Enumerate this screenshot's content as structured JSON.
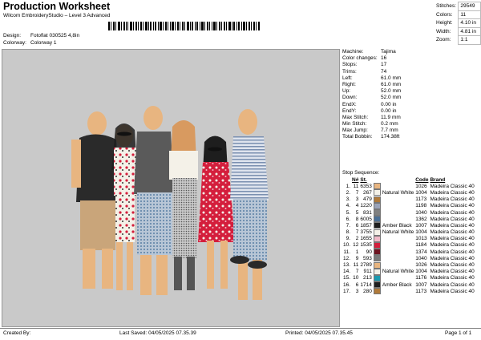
{
  "header": {
    "title": "Production Worksheet",
    "subtitle": "Wilcom EmbroideryStudio – Level 3 Advanced",
    "design_label": "Design:",
    "design_value": "Fotoflat 030525 4,8in",
    "colorway_label": "Colorway:",
    "colorway_value": "Colorway 1"
  },
  "stats": [
    {
      "label": "Stitches:",
      "value": "29549"
    },
    {
      "label": "Colors:",
      "value": "11"
    },
    {
      "label": "Height:",
      "value": "4.10 in"
    },
    {
      "label": "Width:",
      "value": "4.81 in"
    },
    {
      "label": "Zoom:",
      "value": "1:1"
    }
  ],
  "machine_info": [
    {
      "label": "Machine:",
      "value": "Tajima"
    },
    {
      "label": "Color changes:",
      "value": "16"
    },
    {
      "label": "Stops:",
      "value": "17"
    },
    {
      "label": "Trims:",
      "value": "74"
    },
    {
      "label": "Left:",
      "value": "61.0 mm"
    },
    {
      "label": "Right:",
      "value": "61.0 mm"
    },
    {
      "label": "Up:",
      "value": "52.0 mm"
    },
    {
      "label": "Down:",
      "value": "52.0 mm"
    },
    {
      "label": "EndX:",
      "value": "0.00 in"
    },
    {
      "label": "EndY:",
      "value": "0.00 in"
    },
    {
      "label": "Max Stitch:",
      "value": "11.9 mm"
    },
    {
      "label": "Min Stitch:",
      "value": "0.2 mm"
    },
    {
      "label": "Max Jump:",
      "value": "7.7 mm"
    },
    {
      "label": "Total Bobbin:",
      "value": "174.38ft"
    }
  ],
  "stop_sequence": {
    "title": "Stop Sequence:",
    "columns": [
      "N#",
      "St.",
      "Code",
      "Brand"
    ],
    "rows": [
      {
        "stop": "1.",
        "n": "11",
        "st": "6353",
        "color": "#e8b580",
        "name": "",
        "code": "1026",
        "brand": "Madeira Classic 40"
      },
      {
        "stop": "2.",
        "n": "7",
        "st": "267",
        "color": "#f4f1e8",
        "name": "Natural White",
        "code": "1004",
        "brand": "Madeira Classic 40"
      },
      {
        "stop": "3.",
        "n": "3",
        "st": "479",
        "color": "#b07a3a",
        "name": "",
        "code": "1173",
        "brand": "Madeira Classic 40"
      },
      {
        "stop": "4.",
        "n": "4",
        "st": "1220",
        "color": "#9aa3b8",
        "name": "",
        "code": "1198",
        "brand": "Madeira Classic 40"
      },
      {
        "stop": "5.",
        "n": "5",
        "st": "831",
        "color": "#808080",
        "name": "",
        "code": "1040",
        "brand": "Madeira Classic 40"
      },
      {
        "stop": "6.",
        "n": "8",
        "st": "6005",
        "color": "#4a6f95",
        "name": "",
        "code": "1362",
        "brand": "Madeira Classic 40"
      },
      {
        "stop": "7.",
        "n": "6",
        "st": "1857",
        "color": "#1e1e1e",
        "name": "Amber Black",
        "code": "1007",
        "brand": "Madeira Classic 40"
      },
      {
        "stop": "8.",
        "n": "7",
        "st": "3755",
        "color": "#f4f1e8",
        "name": "Natural White",
        "code": "1004",
        "brand": "Madeira Classic 40"
      },
      {
        "stop": "9.",
        "n": "2",
        "st": "1655",
        "color": "#f0b8c6",
        "name": "",
        "code": "1013",
        "brand": "Madeira Classic 40"
      },
      {
        "stop": "10.",
        "n": "12",
        "st": "1535",
        "color": "#d41e3c",
        "name": "",
        "code": "1184",
        "brand": "Madeira Classic 40"
      },
      {
        "stop": "11.",
        "n": "1",
        "st": "90",
        "color": "#6e1420",
        "name": "",
        "code": "1374",
        "brand": "Madeira Classic 40"
      },
      {
        "stop": "12.",
        "n": "9",
        "st": "593",
        "color": "#7a7a7a",
        "name": "",
        "code": "1040",
        "brand": "Madeira Classic 40"
      },
      {
        "stop": "13.",
        "n": "11",
        "st": "2789",
        "color": "#e8b580",
        "name": "",
        "code": "1026",
        "brand": "Madeira Classic 40"
      },
      {
        "stop": "14.",
        "n": "7",
        "st": "911",
        "color": "#f4f1e8",
        "name": "Natural White",
        "code": "1004",
        "brand": "Madeira Classic 40"
      },
      {
        "stop": "15.",
        "n": "10",
        "st": "213",
        "color": "#1a9ab0",
        "name": "",
        "code": "1176",
        "brand": "Madeira Classic 40"
      },
      {
        "stop": "16.",
        "n": "6",
        "st": "1714",
        "color": "#1e1e1e",
        "name": "Amber Black",
        "code": "1007",
        "brand": "Madeira Classic 40"
      },
      {
        "stop": "17.",
        "n": "3",
        "st": "280",
        "color": "#b07a3a",
        "name": "",
        "code": "1173",
        "brand": "Madeira Classic 40"
      }
    ]
  },
  "footer": {
    "created_by": "Created By:",
    "last_saved": "Last Saved: 04/05/2025 07.35.39",
    "printed": "Printed: 04/05/2025 07.35.45",
    "page": "Page 1 of 1"
  }
}
